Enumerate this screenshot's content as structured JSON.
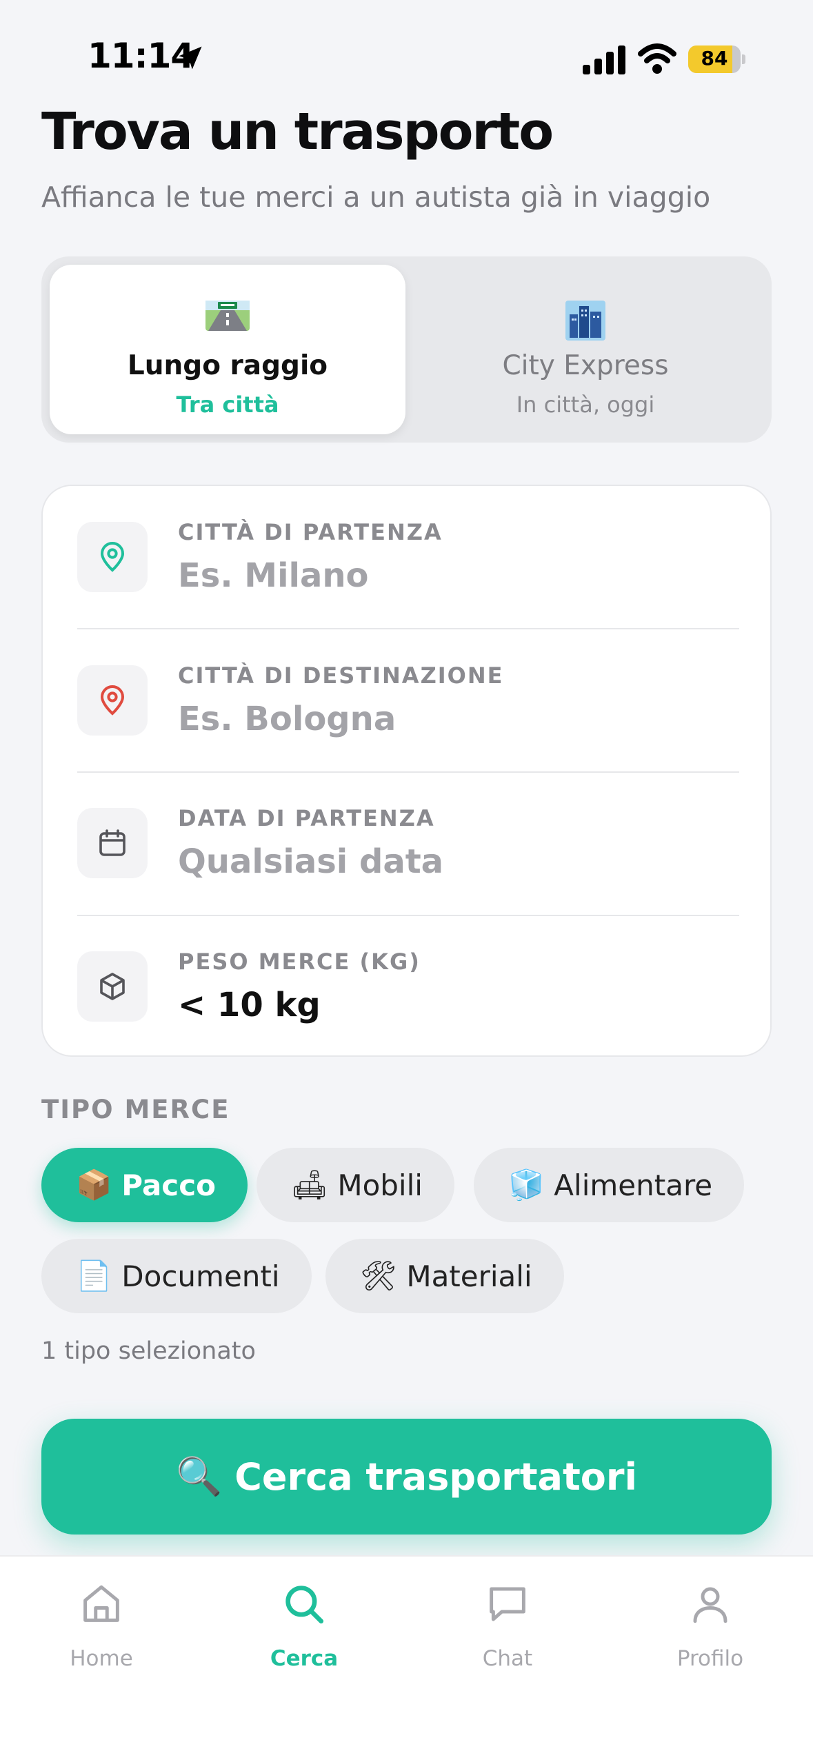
{
  "status_bar": {
    "time": "11:14",
    "battery": "84",
    "battery_level": 0.84
  },
  "header": {
    "title": "Trova un trasporto",
    "subtitle": "Affianca le tue merci a un autista già in viaggio"
  },
  "mode_tabs": [
    {
      "icon": "motorway-emoji",
      "label": "Lungo raggio",
      "sublabel": "Tra città",
      "selected": true
    },
    {
      "icon": "cityscape-emoji",
      "label": "City Express",
      "sublabel": "In città, oggi",
      "selected": false
    }
  ],
  "form": {
    "departure": {
      "icon": "location-pin-icon",
      "label": "CITTÀ DI PARTENZA",
      "placeholder": "Es. Milano"
    },
    "destination": {
      "icon": "location-pin-icon",
      "label": "CITTÀ DI DESTINAZIONE",
      "placeholder": "Es. Bologna"
    },
    "date": {
      "icon": "calendar-icon",
      "label": "DATA DI PARTENZA",
      "placeholder": "Qualsiasi data"
    },
    "weight": {
      "icon": "box-icon",
      "label": "PESO MERCE (KG)",
      "value": "< 10 kg"
    }
  },
  "goods_type": {
    "label": "TIPO MERCE",
    "chips": [
      {
        "emoji": "📦",
        "icon": "package-emoji",
        "label": "Pacco",
        "selected": true
      },
      {
        "emoji": "🛋",
        "icon": "sofa-emoji",
        "label": "Mobili",
        "selected": false
      },
      {
        "emoji": "🧊",
        "icon": "ice-emoji",
        "label": "Alimentare",
        "selected": false
      },
      {
        "emoji": "📄",
        "icon": "document-emoji",
        "label": "Documenti",
        "selected": false
      },
      {
        "emoji": "🛠",
        "icon": "tools-emoji",
        "label": "Materiali",
        "selected": false
      }
    ],
    "selected_count": "1 tipo selezionato"
  },
  "cta": {
    "emoji": "🔍",
    "label": "Cerca trasportatori"
  },
  "tab_bar": [
    {
      "icon": "home-icon",
      "label": "Home",
      "active": false
    },
    {
      "icon": "search-icon",
      "label": "Cerca",
      "active": true
    },
    {
      "icon": "chat-icon",
      "label": "Chat",
      "active": false
    },
    {
      "icon": "profile-icon",
      "label": "Profilo",
      "active": false
    }
  ],
  "colors": {
    "accent": "#1fbf9b",
    "background": "#f4f5f8",
    "destination_pin": "#e04b3f"
  }
}
